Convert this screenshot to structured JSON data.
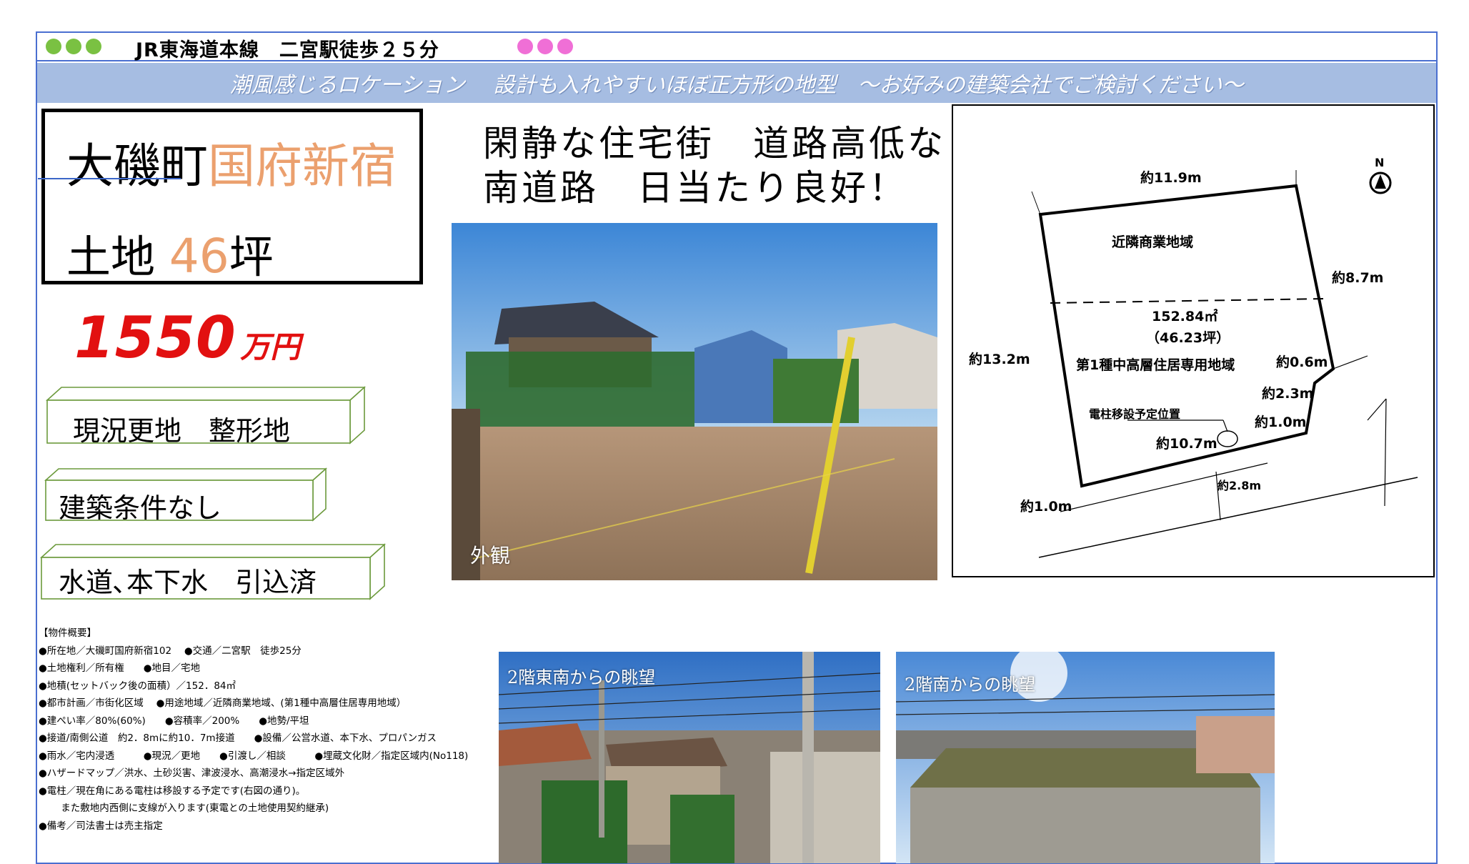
{
  "header": {
    "access": "JR東海道本線　二宮駅徒歩２５分"
  },
  "banner": {
    "text": "潮風感じるロケーション　 設計も入れやすいほぼ正方形の地型　～お好みの建築会社でご検討ください～"
  },
  "title": {
    "town": "大磯町",
    "district": "国府新宿",
    "land_label": "土地",
    "tsubo_value": "46",
    "tsubo_unit": "坪"
  },
  "price": {
    "amount": "1550",
    "unit": "万円"
  },
  "features": [
    "現況更地　整形地",
    "建築条件なし",
    "水道､本下水　引込済"
  ],
  "headline": {
    "line1": "閑静な住宅街　道路高低なし",
    "line2": "南道路　日当たり良好！"
  },
  "photos": {
    "exterior_caption": "外観",
    "view_southeast_caption": "2階東南からの眺望",
    "view_south_caption": "2階南からの眺望"
  },
  "overview": [
    "【物件概要】",
    "●所在地／大磯町国府新宿102　 ●交通／二宮駅　徒歩25分",
    "●土地権利／所有権　　●地目／宅地",
    "●地積(セットバック後の面積）／152．84㎡",
    "●都市計画／市街化区域　 ●用途地域／近隣商業地域、(第1種中高層住居専用地域）",
    "●建ぺい率／80%(60%)　　●容積率／200%　　●地勢/平坦",
    "●接道/南側公道　約2．8mに約10．7m接道　　●設備／公営水道、本下水、プロパンガス",
    "●雨水／宅内浸透　　　●現況／更地　　●引渡し／相談　　　●埋蔵文化財／指定区域内(No118)",
    "●ハザードマップ／洪水、土砂災害、津波浸水、高潮浸水→指定区域外",
    "●電柱／現在角にある電柱は移設する予定です(右図の通り)。",
    "　　 また敷地内西側に支線が入ります(東電との土地使用契約継承)",
    "●備考／司法書士は売主指定"
  ],
  "plan": {
    "north": "N",
    "top_width": "約11.9m",
    "zone_upper": "近隣商業地域",
    "east_upper": "約8.7m",
    "area_sqm": "152.84㎡",
    "area_tsubo": "（46.23坪）",
    "west": "約13.2m",
    "zone_lower": "第1種中高層住居専用地域",
    "corner_06": "約0.6m",
    "corner_23": "約2.3m",
    "corner_10a": "約1.0m",
    "pole_note": "電柱移設予定位置",
    "frontage": "約10.7m",
    "road_width": "約2.8m",
    "corner_10b": "約1.0m"
  },
  "colors": {
    "frame": "#4a6fd0",
    "banner": "#a6bde2",
    "accent_orange": "#eba06e",
    "price_red": "#e21010",
    "box_green": "#6c9a3c",
    "dot_green": "#7ac142",
    "dot_pink": "#f06fd6"
  }
}
